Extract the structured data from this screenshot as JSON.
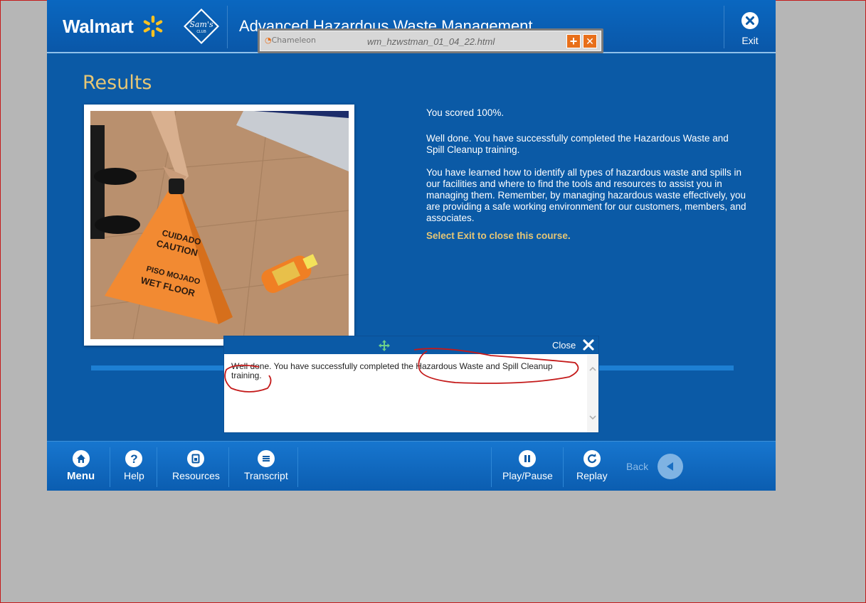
{
  "header": {
    "brand": "Walmart",
    "sams_line1": "Sam's",
    "sams_line2": "CLUB",
    "course_title": "Advanced Hazardous Waste Management",
    "exit_label": "Exit"
  },
  "chameleon": {
    "logo_text": "Chameleon",
    "file_name": "wm_hzwstman_01_04_22.html",
    "add_symbol": "+",
    "close_symbol": "✕"
  },
  "main": {
    "title": "Results",
    "score": "You scored 100%.",
    "para1": "Well done.  You have successfully completed the Hazardous Waste and Spill Cleanup training.",
    "para2": "You have learned how to identify all types of hazardous waste and spills in our facilities and where to find the tools and resources to assist you in managing them.  Remember, by managing hazardous waste effectively, you are providing a safe working environment for our customers, members, and associates.",
    "exit_note": "Select Exit to close this course.",
    "sign_line1": "CUIDADO",
    "sign_line2": "CAUTION",
    "sign_line3": "PISO MOJADO",
    "sign_line4": "WET FLOOR"
  },
  "transcript_popup": {
    "close_label": "Close",
    "text": "Well done.  You have successfully completed the Hazardous Waste and Spill Cleanup training."
  },
  "footer": {
    "menu": "Menu",
    "help": "Help",
    "resources": "Resources",
    "transcript": "Transcript",
    "play_pause": "Play/Pause",
    "replay": "Replay",
    "back": "Back"
  },
  "colors": {
    "course_blue": "#0b5aa6",
    "gold_text": "#e6c675",
    "annotation_red": "#c41a1a",
    "chameleon_orange": "#e86f1a"
  }
}
